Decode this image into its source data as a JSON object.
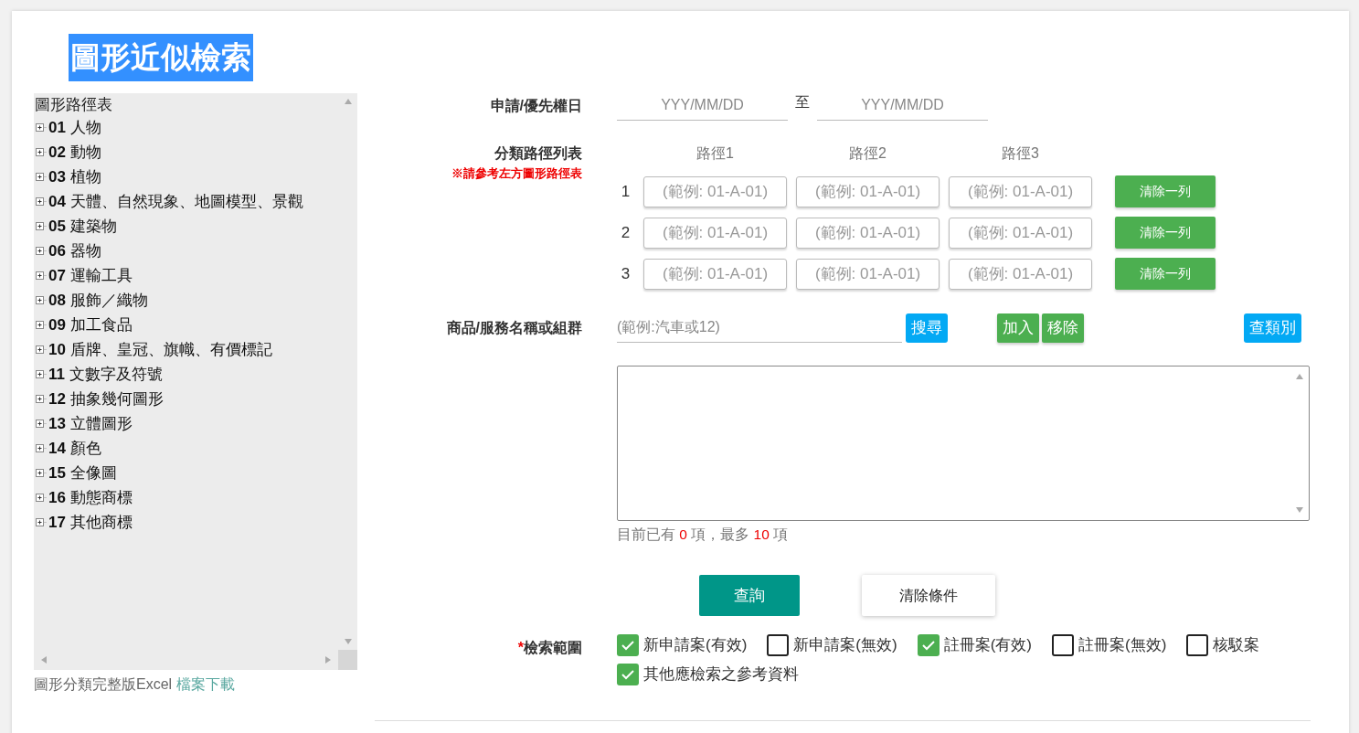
{
  "title": "圖形近似檢索",
  "tree": {
    "heading": "圖形路徑表",
    "items": [
      {
        "code": "01",
        "name": "人物",
        "expanded": false
      },
      {
        "code": "02",
        "name": "動物",
        "expanded": false
      },
      {
        "code": "03",
        "name": "植物",
        "expanded": false
      },
      {
        "code": "04",
        "name": "天體、自然現象、地圖模型、景觀",
        "expanded": false
      },
      {
        "code": "05",
        "name": "建築物",
        "expanded": false
      },
      {
        "code": "06",
        "name": "器物",
        "expanded": false
      },
      {
        "code": "07",
        "name": "運輸工具",
        "expanded": false
      },
      {
        "code": "08",
        "name": "服飾／織物",
        "expanded": false
      },
      {
        "code": "09",
        "name": "加工食品",
        "expanded": false
      },
      {
        "code": "10",
        "name": "盾牌、皇冠、旗幟、有價標記",
        "expanded": false
      },
      {
        "code": "11",
        "name": "文數字及符號",
        "expanded": false
      },
      {
        "code": "12",
        "name": "抽象幾何圖形",
        "expanded": false
      },
      {
        "code": "13",
        "name": "立體圖形",
        "expanded": false
      },
      {
        "code": "14",
        "name": "顏色",
        "expanded": false
      },
      {
        "code": "15",
        "name": "全像圖",
        "expanded": false
      },
      {
        "code": "16",
        "name": "動態商標",
        "expanded": false
      },
      {
        "code": "17",
        "name": "其他商標",
        "expanded": false
      }
    ]
  },
  "download": {
    "text": "圖形分類完整版Excel",
    "link": "檔案下載"
  },
  "date": {
    "label": "申請/優先權日",
    "from_placeholder": "YYY/MM/DD",
    "separator": "至",
    "to_placeholder": "YYY/MM/DD"
  },
  "paths": {
    "label": "分類路徑列表",
    "note": "※請參考左方圖形路徑表",
    "columns": [
      "路徑1",
      "路徑2",
      "路徑3"
    ],
    "rows": [
      {
        "number": "1",
        "placeholders": [
          "(範例: 01-A-01)",
          "(範例: 01-A-01)",
          "(範例: 01-A-01)"
        ],
        "button": "清除一列"
      },
      {
        "number": "2",
        "placeholders": [
          "(範例: 01-A-01)",
          "(範例: 01-A-01)",
          "(範例: 01-A-01)"
        ],
        "button": "清除一列"
      },
      {
        "number": "3",
        "placeholders": [
          "(範例: 01-A-01)",
          "(範例: 01-A-01)",
          "(範例: 01-A-01)"
        ],
        "button": "清除一列"
      }
    ]
  },
  "goods": {
    "label": "商品/服務名稱或組群",
    "placeholder": "(範例:汽車或12)",
    "search_button": "搜尋",
    "add_button": "加入",
    "remove_button": "移除",
    "class_button": "查類別",
    "count_text": [
      {
        "kind": "text",
        "text": "目前已有 "
      },
      {
        "kind": "number",
        "text": "0"
      },
      {
        "kind": "text",
        "text": " 項，最多 "
      },
      {
        "kind": "number",
        "text": "10"
      },
      {
        "kind": "text",
        "text": " 項"
      }
    ]
  },
  "actions": {
    "query": "查詢",
    "clear": "清除條件"
  },
  "scope": {
    "required_mark": "*",
    "label": "檢索範圍",
    "options": [
      {
        "label": "新申請案(有效)",
        "checked": true
      },
      {
        "label": "新申請案(無效)",
        "checked": false
      },
      {
        "label": "註冊案(有效)",
        "checked": true
      },
      {
        "label": "註冊案(無效)",
        "checked": false
      },
      {
        "label": "核駁案",
        "checked": false
      },
      {
        "label": "其他應檢索之參考資料",
        "checked": true
      }
    ]
  }
}
